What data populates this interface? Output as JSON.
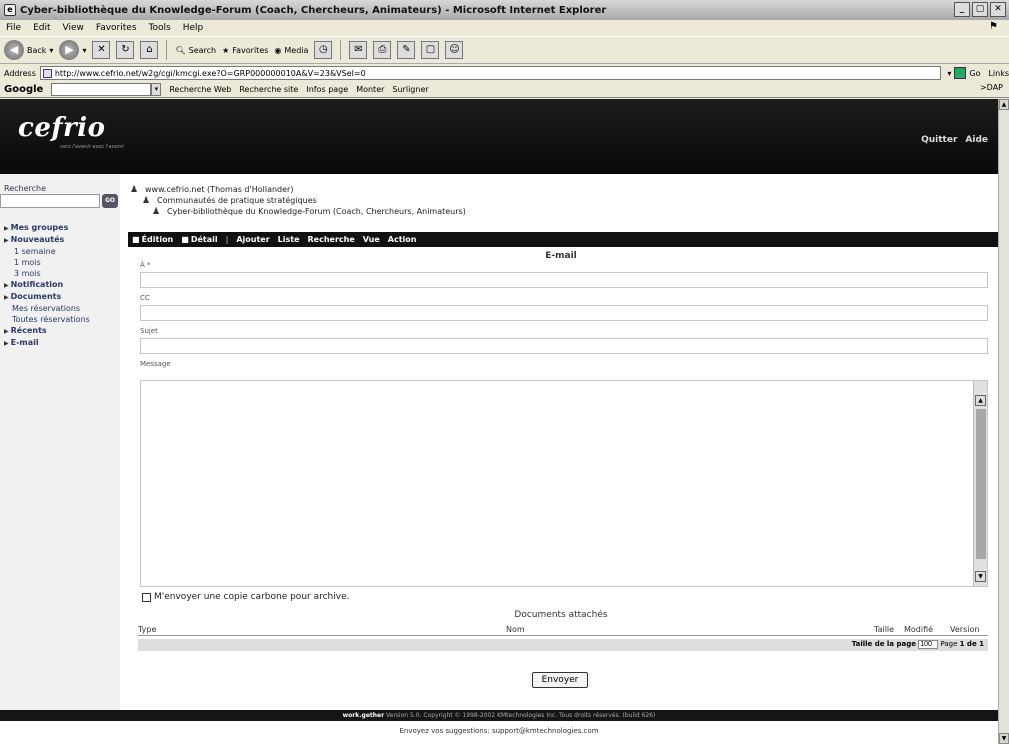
{
  "window": {
    "title": "Cyber-bibliothèque du Knowledge-Forum (Coach, Chercheurs, Animateurs) - Microsoft Internet Explorer",
    "buttons": [
      "_",
      "▢",
      "✕"
    ]
  },
  "menu": [
    "File",
    "Edit",
    "View",
    "Favorites",
    "Tools",
    "Help"
  ],
  "toolbar": {
    "back": "Back",
    "search": "Search",
    "favorites": "Favorites",
    "media": "Media"
  },
  "address": {
    "label": "Address",
    "url": "http://www.cefrio.net/w2g/cgi/kmcgi.exe?O=GRP000000010A&V=23&VSel=0",
    "go": "Go",
    "links": "Links"
  },
  "google": {
    "logo": "Google",
    "recherche_web": "Recherche Web",
    "recherche_site": "Recherche site",
    "page_info": "Infos page",
    "monter": "Monter",
    "surligner": "Surligner",
    "right": ">DAP"
  },
  "banner": {
    "logo": "cefrio",
    "tagline": "vers l'avenir avec l'avenir",
    "quitter": "Quitter",
    "aide": "Aide"
  },
  "sidebar": {
    "search_label": "Recherche",
    "search_go": "GO",
    "items": [
      {
        "label": "Mes groupes",
        "type": "item"
      },
      {
        "label": "Nouveautés",
        "type": "item"
      },
      {
        "label": "1 semaine",
        "type": "sub"
      },
      {
        "label": "1 mois",
        "type": "sub"
      },
      {
        "label": "3 mois",
        "type": "sub"
      },
      {
        "label": "Notification",
        "type": "item"
      },
      {
        "label": "Documents",
        "type": "item"
      },
      {
        "label": "Mes réservations",
        "type": "plain"
      },
      {
        "label": "Toutes réservations",
        "type": "plain"
      },
      {
        "label": "Récents",
        "type": "item"
      },
      {
        "label": "E-mail",
        "type": "item"
      }
    ]
  },
  "breadcrumb": {
    "level1": "www.cefrio.net (Thomas d'Hollander)",
    "level2": "Communautés de pratique stratégiques",
    "level3": "Cyber-bibliothèque du Knowledge-Forum (Coach, Chercheurs, Animateurs)"
  },
  "actions": {
    "edition": "Édition",
    "detail": "Détail",
    "pipe": "|",
    "ajouter": "Ajouter",
    "liste": "Liste",
    "recherche": "Recherche",
    "vue": "Vue",
    "action": "Action"
  },
  "form": {
    "title": "E-mail",
    "to_label": "À *",
    "cc_label": "CC",
    "subject_label": "Sujet",
    "message_label": "Message",
    "to_value": "",
    "cc_value": "",
    "subject_value": "",
    "message_value": "",
    "carbon_copy": "M'envoyer une copie carbone pour archive.",
    "send": "Envoyer"
  },
  "documents": {
    "title": "Documents attachés",
    "columns": {
      "type": "Type",
      "nom": "Nom",
      "taille": "Taille",
      "modifie": "Modifié",
      "version": "Version"
    },
    "page_size_label": "Taille de la page",
    "page_size": "100",
    "page_label": "Page",
    "page_value": "1 de 1"
  },
  "footer": {
    "brand": "work.gether",
    "text": "Version 5.0. Copyright © 1998-2002 KMtechnologies Inc. Tous droits réservés. (build 626)",
    "suggestions": "Envoyez vos suggestions: support@kmtechnologies.com"
  }
}
